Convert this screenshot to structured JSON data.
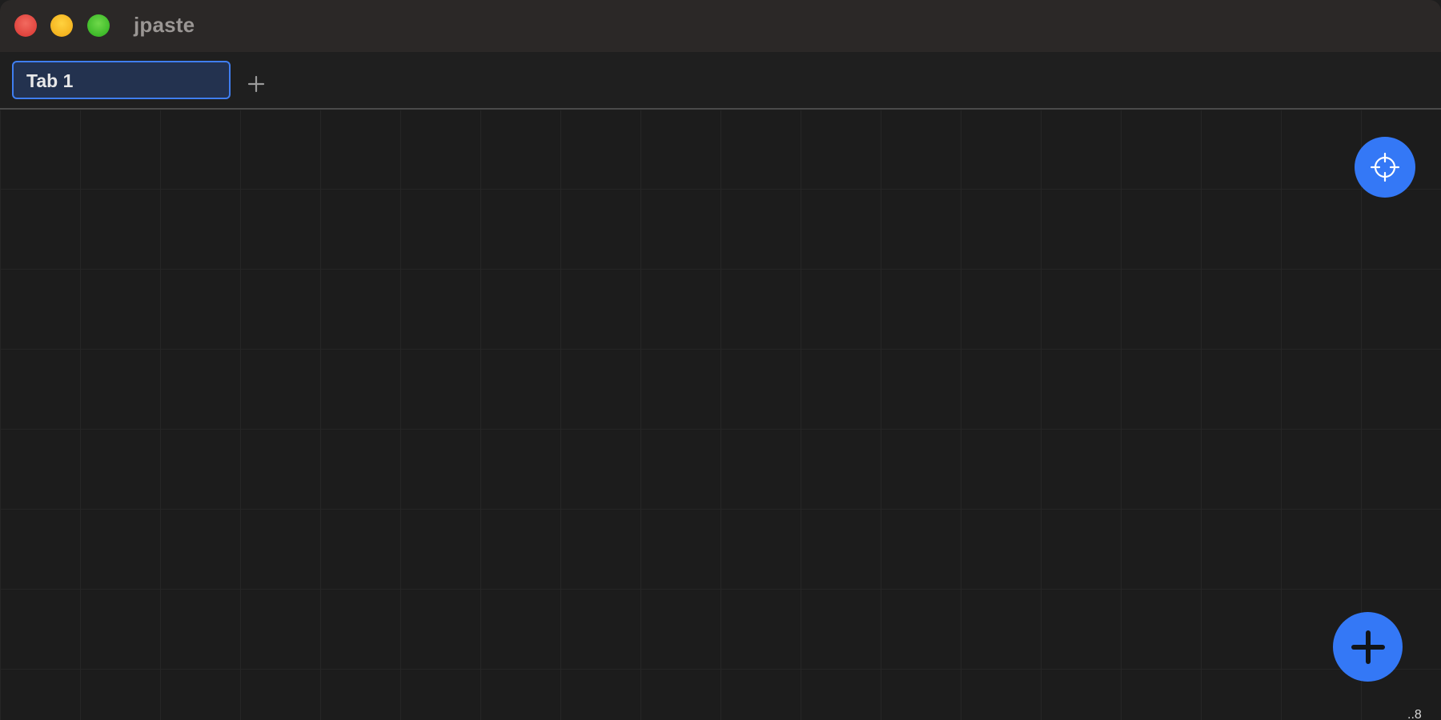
{
  "window": {
    "title": "jpaste"
  },
  "tabs": [
    {
      "label": "Tab 1",
      "active": true
    }
  ],
  "toolbar": {
    "add_tab_icon": "plus-icon"
  },
  "canvas": {
    "recenter_icon": "crosshair-icon",
    "add_item_icon": "plus-icon",
    "accent_color": "#3478f6",
    "corner_text": "..8"
  }
}
